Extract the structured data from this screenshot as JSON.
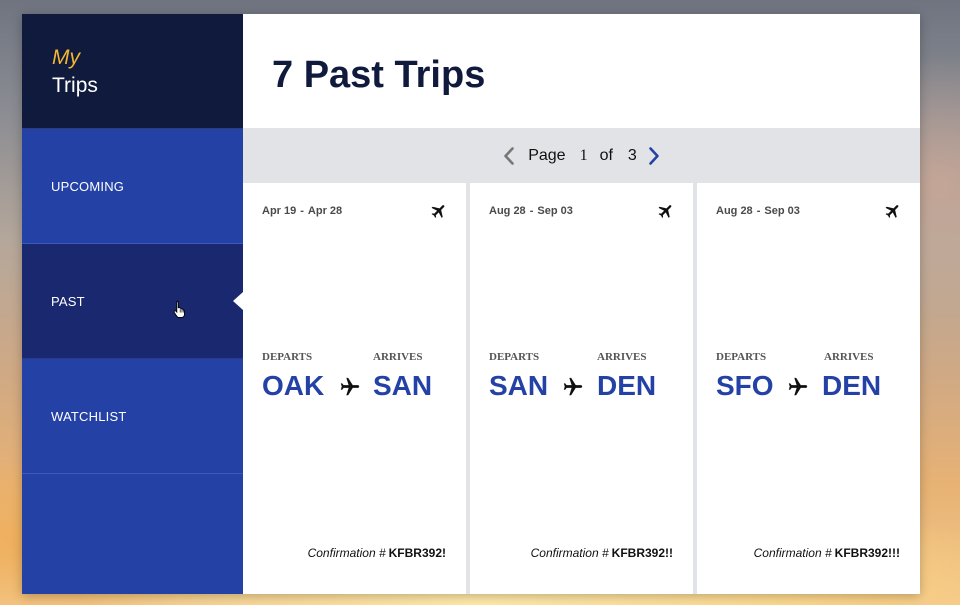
{
  "sidebar": {
    "brand": {
      "my": "My",
      "trips": "Trips"
    },
    "items": [
      {
        "label": "UPCOMING",
        "active": false
      },
      {
        "label": "PAST",
        "active": true
      },
      {
        "label": "WATCHLIST",
        "active": false
      }
    ]
  },
  "main": {
    "title": "7 Past Trips",
    "pager": {
      "label": "Page",
      "current": "1",
      "of": "of",
      "total": "3"
    },
    "trips": [
      {
        "start": "Apr 19",
        "end": "Apr 28",
        "departs_label": "DEPARTS",
        "arrives_label": "ARRIVES",
        "from": "OAK",
        "to": "SAN",
        "confirmation_label": "Confirmation #",
        "confirmation": "KFBR392!"
      },
      {
        "start": "Aug 28",
        "end": "Sep 03",
        "departs_label": "DEPARTS",
        "arrives_label": "ARRIVES",
        "from": "SAN",
        "to": "DEN",
        "confirmation_label": "Confirmation #",
        "confirmation": "KFBR392!!"
      },
      {
        "start": "Aug 28",
        "end": "Sep 03",
        "departs_label": "DEPARTS",
        "arrives_label": "ARRIVES",
        "from": "SFO",
        "to": "DEN",
        "confirmation_label": "Confirmation #",
        "confirmation": "KFBR392!!!"
      }
    ],
    "date_separator": "-"
  },
  "colors": {
    "brand_dark": "#0f1a3c",
    "sidebar": "#2441a6",
    "sidebar_active": "#1a2870",
    "accent_gold": "#f2b632",
    "airport_code": "#2441a6",
    "pager_next": "#2441a6",
    "pager_prev": "#777777"
  },
  "icons": {
    "pager_prev": "chevron-left-icon",
    "pager_next": "chevron-right-icon",
    "trip": "airplane-icon",
    "route": "airplane-right-icon",
    "cursor": "hand-pointer-cursor"
  }
}
